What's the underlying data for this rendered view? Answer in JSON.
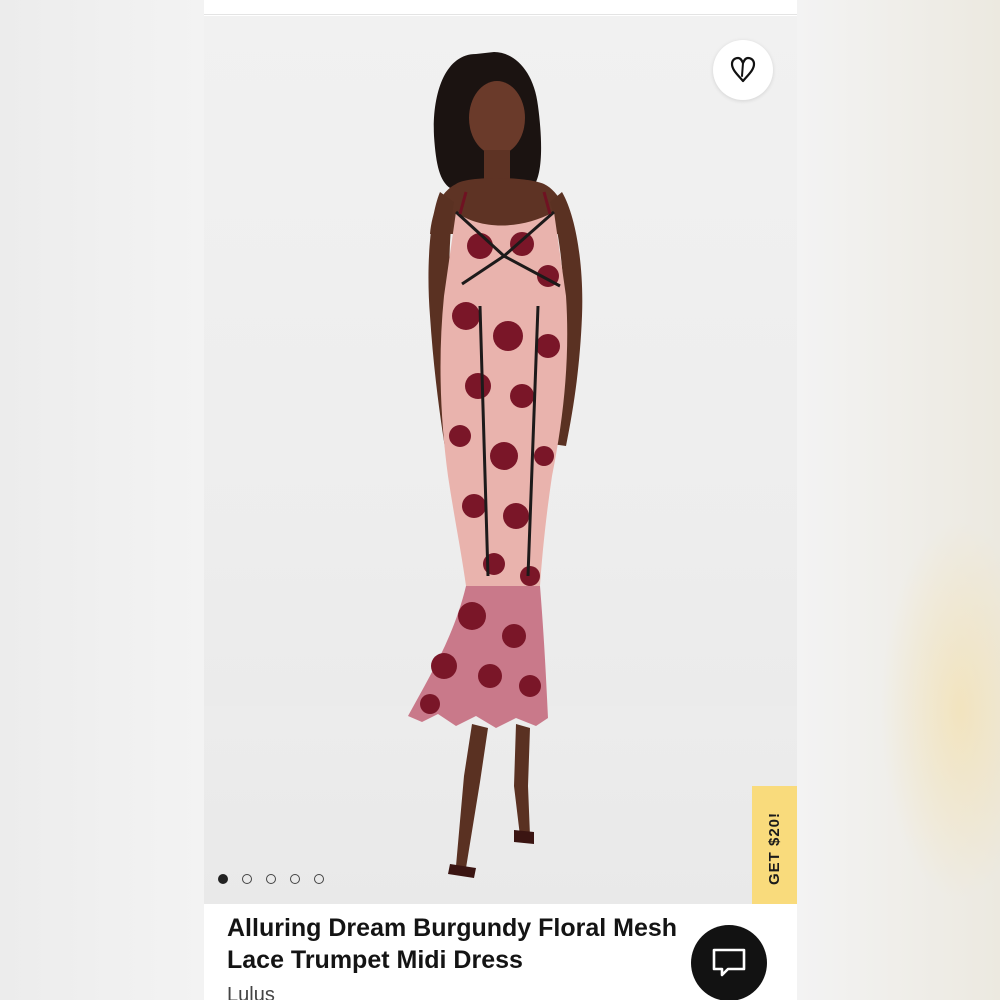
{
  "product": {
    "title_line1": "Alluring Dream Burgundy Floral Mesh",
    "title_line2": "Lace Trumpet Midi Dress",
    "brand": "Lulus"
  },
  "gallery": {
    "image_count": 5,
    "active_index": 0
  },
  "promo": {
    "label": "GET $20!",
    "color": "#f9db7c"
  },
  "actions": {
    "favorite_icon": "heart-outline-icon",
    "chat_icon": "chat-bubble-icon"
  },
  "colors": {
    "dress_base": "#e9b3ad",
    "dress_lace": "#7a1628",
    "trim": "#1d1a1a"
  }
}
